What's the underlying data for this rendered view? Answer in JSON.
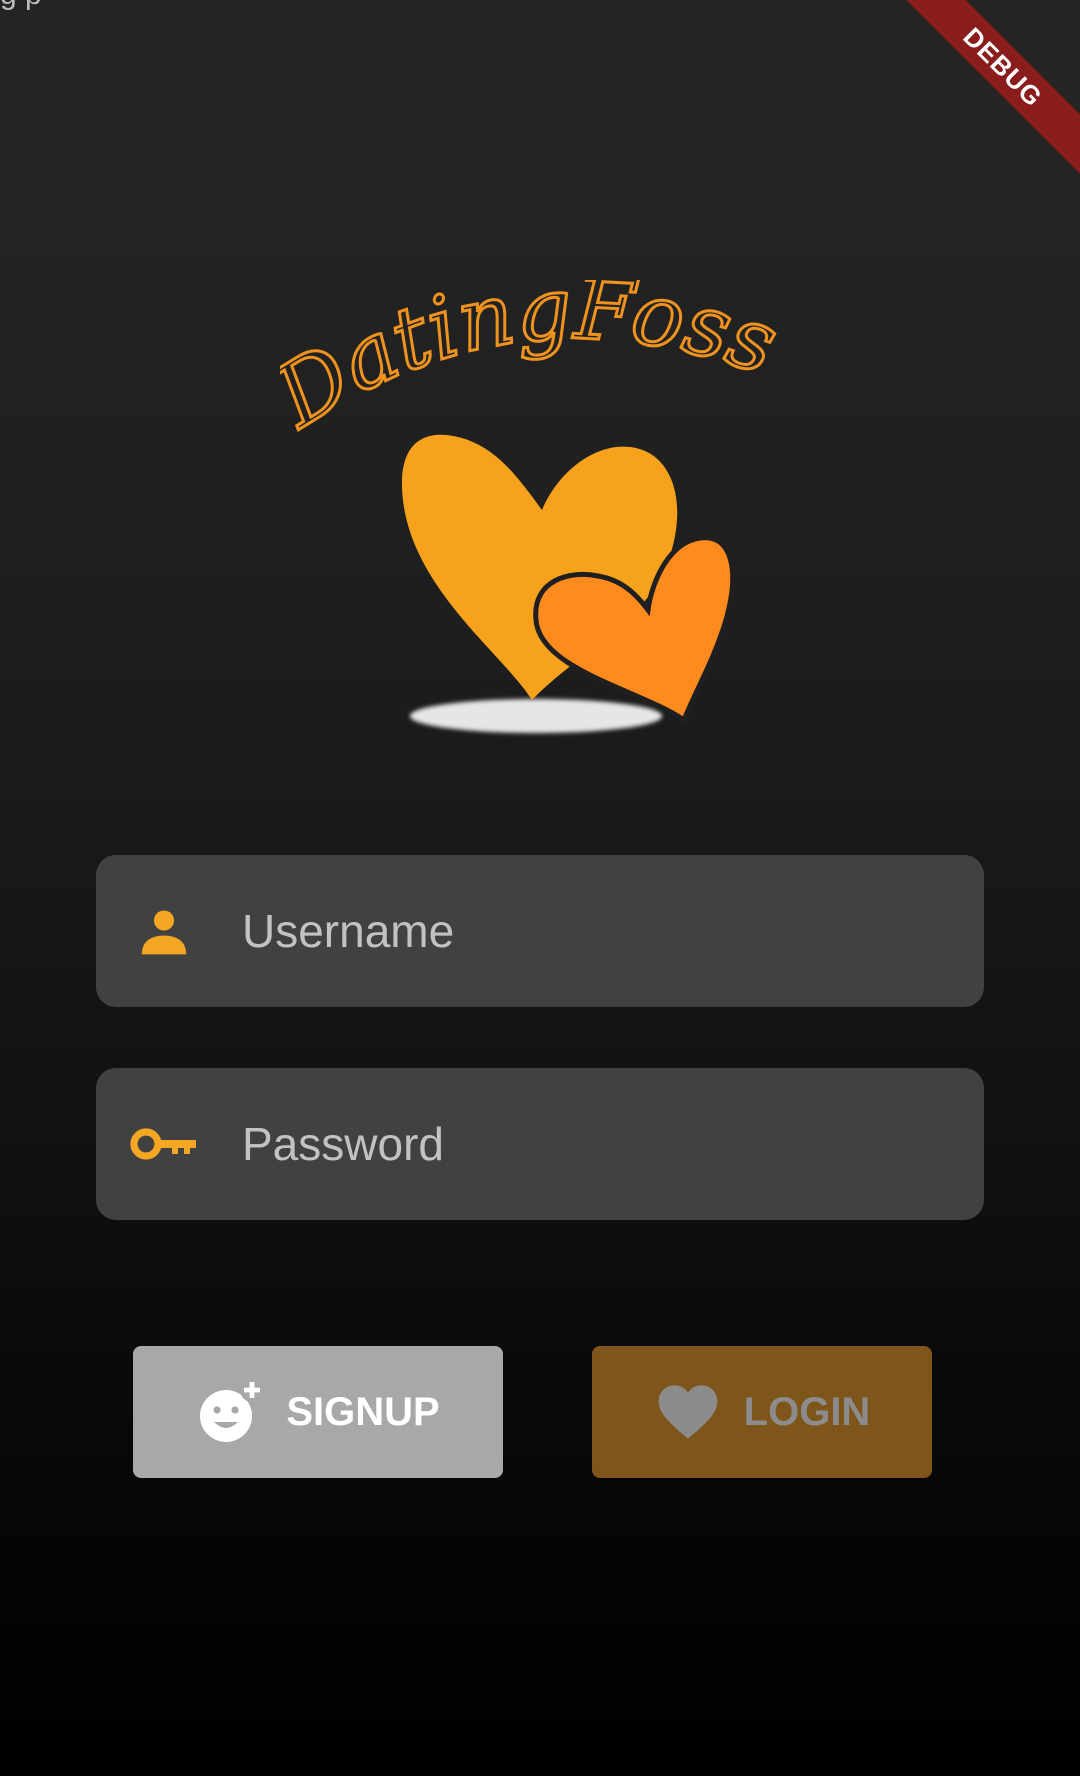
{
  "status_bar": {
    "text": "g p"
  },
  "debug_banner": {
    "label": "DEBUG"
  },
  "logo": {
    "title": "DatingFoss"
  },
  "form": {
    "username": {
      "placeholder": "Username",
      "value": ""
    },
    "password": {
      "placeholder": "Password",
      "value": ""
    }
  },
  "buttons": {
    "signup": {
      "label": "SIGNUP",
      "icon": "face-plus-icon"
    },
    "login": {
      "label": "LOGIN",
      "icon": "heart-icon"
    }
  },
  "colors": {
    "accent": "#f5a623",
    "heart_big": "#f7a21d",
    "heart_small": "#ff8a1e",
    "input_bg": "#414141",
    "signup_bg": "#a8a8a8",
    "login_bg": "#7e551a",
    "debug_red": "#8a1c1c"
  }
}
